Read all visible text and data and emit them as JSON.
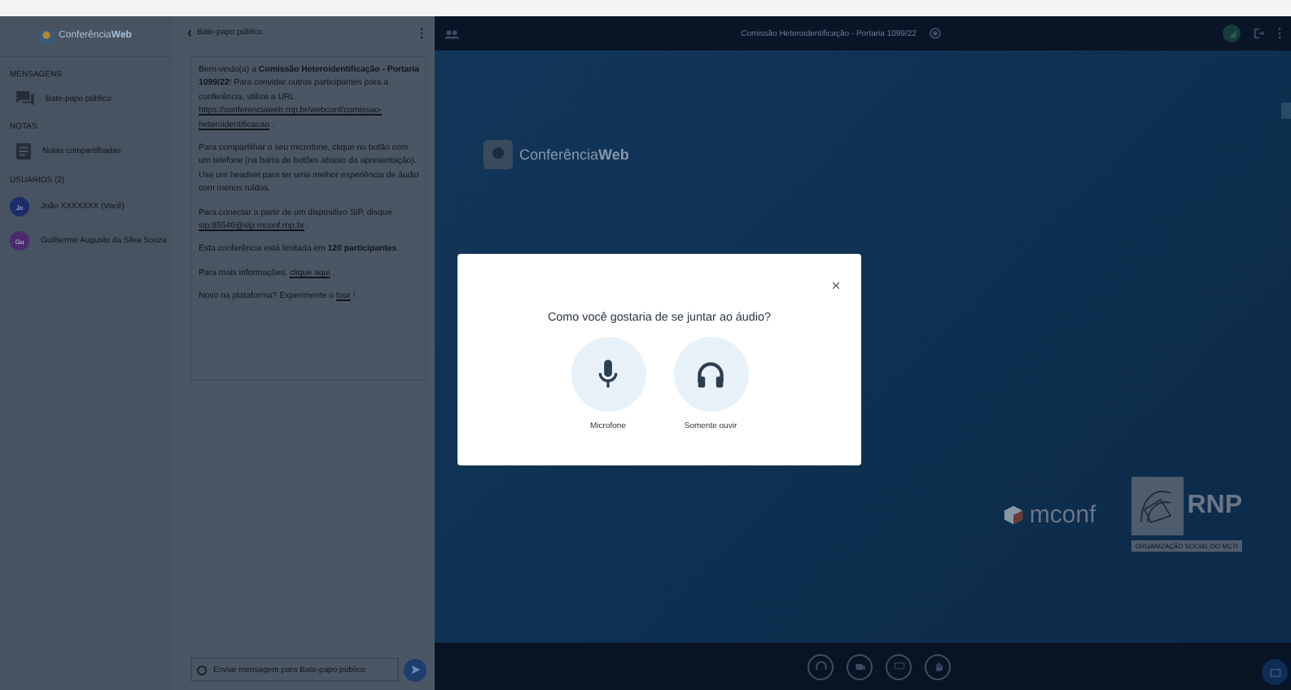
{
  "sidebar": {
    "logo": "Conferência**Web**",
    "sections": [
      {
        "title": "MENSAGENS",
        "items": [
          {
            "kind": "chat",
            "label": "Bate-papo público"
          }
        ]
      },
      {
        "title": "NOTAS",
        "items": [
          {
            "kind": "notes",
            "label": "Notas compartilhadas"
          }
        ]
      },
      {
        "title": "USUÁRIOS (2)",
        "items": [
          {
            "kind": "user",
            "initials": "Jo",
            "label": "João XXXXXXX (Você)",
            "color": "#1d2d6b"
          },
          {
            "kind": "user",
            "initials": "Gu",
            "label": "Guilherme Augusto da Silva Souza",
            "color": "#4b2a6e"
          }
        ]
      }
    ]
  },
  "chat": {
    "title": "Bate-papo público",
    "paragraphs": [
      [
        {
          "kind": "text",
          "text": "Bem-vindo(a) a **Comissão Heteroidentificação - Portaria 1099/22**! Para convidar outros participantes para a conferência, utilize a URL"
        },
        {
          "kind": "link",
          "text": "https://conferenciaweb.rnp.br/webconf/comissao-"
        },
        {
          "kind": "link",
          "text": "heteroidentificacao"
        },
        {
          "kind": "text",
          "text": "."
        }
      ],
      [
        {
          "kind": "text",
          "text": "Para compartilhar o seu microfone, clique no botão com um telefone (na barra de botões abaixo da apresentação). Use um headset para ter uma melhor experiência de áudio com menos ruídos."
        }
      ],
      [
        {
          "kind": "text",
          "text": "Para conectar a partir de um dispositivo SIP, disque"
        },
        {
          "kind": "link",
          "text": "sip:85546@sip.mconf.rnp.br"
        },
        {
          "kind": "text",
          "text": "."
        }
      ],
      [
        {
          "kind": "text",
          "text": "Esta conferência está limitada em **120 participantes**."
        }
      ],
      [
        {
          "kind": "text",
          "text": "Para mais informações,"
        },
        {
          "kind": "link",
          "text": "clique aqui"
        },
        {
          "kind": "text",
          "text": "."
        }
      ],
      [
        {
          "kind": "text",
          "text": "Novo na plataforma? Experimente o"
        },
        {
          "kind": "link",
          "text": "tour"
        },
        {
          "kind": "text",
          "text": "!"
        }
      ]
    ],
    "input": {
      "placeholder": "Enviar mensagem para Bate-papo público"
    }
  },
  "presentation": {
    "title": "Comissão Heteroidentificação - Portaria 1099/22",
    "logo": "Conferência**Web**",
    "mconf": "mconf",
    "rnp": "RNP",
    "rnp_caption": "ORGANIZAÇÃO SOCIAL DO MCTI"
  },
  "dialog": {
    "question": "Como você gostaria de se juntar ao áudio?",
    "options": [
      {
        "kind": "microphone",
        "label": "Microfone"
      },
      {
        "kind": "listen",
        "label": "Somente ouvir"
      }
    ]
  }
}
